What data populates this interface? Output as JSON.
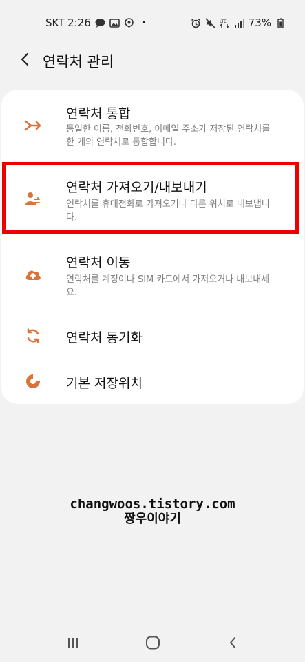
{
  "status_bar": {
    "carrier_time": "SKT 2:26",
    "dot": "•",
    "battery": "73%",
    "icons": [
      "talk-bubble-icon",
      "gallery-icon",
      "location-icon",
      "alarm-icon",
      "mute-icon",
      "lte-signal-icon",
      "signal-bars-icon",
      "battery-icon"
    ]
  },
  "app_bar": {
    "title": "연락처 관리",
    "back_icon": "chevron-left-icon"
  },
  "items": [
    {
      "title": "연락처 통합",
      "desc": "동일한 이름, 전화번호, 이메일 주소가 저장된 연락처를 한 개의 연락처로 통합합니다.",
      "icon": "merge-icon"
    },
    {
      "title": "연락처 가져오기/내보내기",
      "desc": "연락처를 휴대전화로 가져오거나 다른 위치로 내보냅니다.",
      "icon": "contact-transfer-icon"
    },
    {
      "title": "연락처 이동",
      "desc": "연락처를 계정이나 SIM 카드에서 가져오거나 내보내세요.",
      "icon": "cloud-upload-icon"
    },
    {
      "title": "연락처 동기화",
      "desc": "",
      "icon": "sync-icon"
    },
    {
      "title": "기본 저장위치",
      "desc": "",
      "icon": "storage-icon"
    }
  ],
  "watermark": {
    "line1": "changwoos.tistory.com",
    "line2": "짱우이야기"
  },
  "colors": {
    "accent": "#d8743a",
    "highlight": "#ee0000",
    "background": "#f2f2f2"
  },
  "nav": {
    "icons": [
      "recent-apps-icon",
      "home-icon",
      "back-icon"
    ]
  }
}
